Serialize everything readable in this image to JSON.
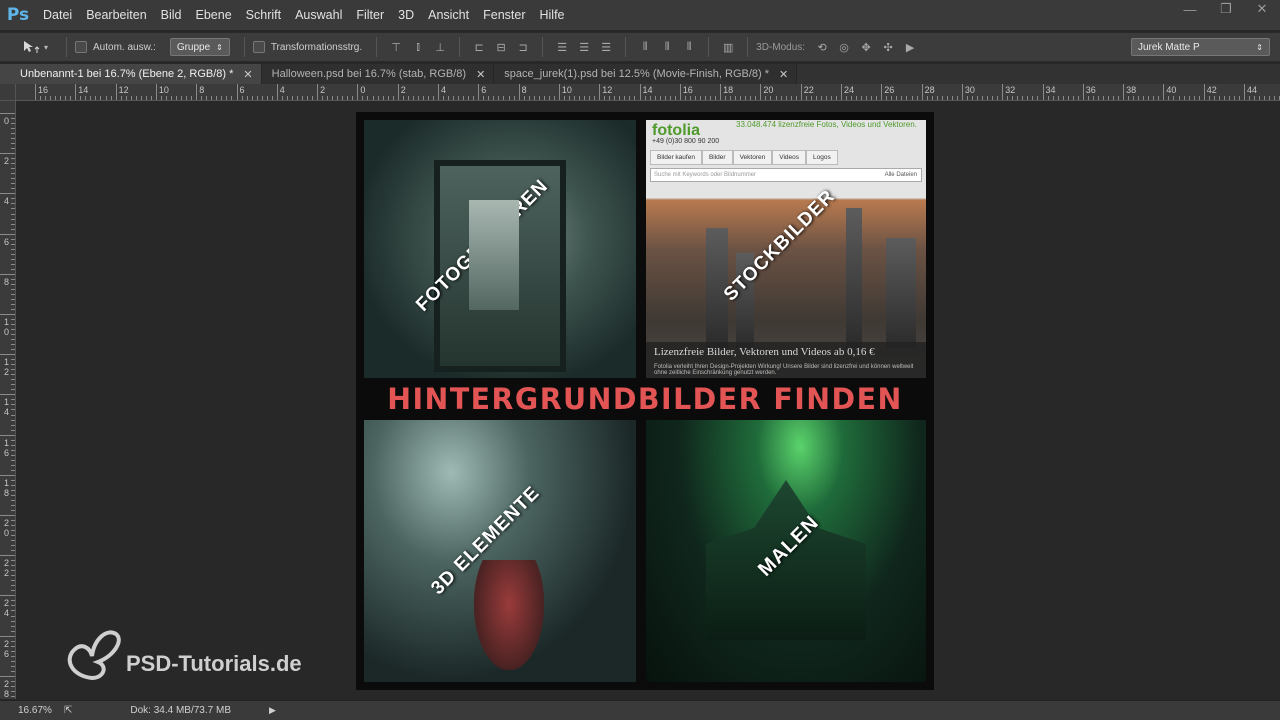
{
  "app": {
    "logo": "Ps"
  },
  "menu": [
    "Datei",
    "Bearbeiten",
    "Bild",
    "Ebene",
    "Schrift",
    "Auswahl",
    "Filter",
    "3D",
    "Ansicht",
    "Fenster",
    "Hilfe"
  ],
  "window_controls": {
    "minimize": "—",
    "restore": "❐",
    "close": "✕"
  },
  "options": {
    "auto_select_label": "Autom. ausw.:",
    "auto_select_value": "Gruppe",
    "transform_label": "Transformationsstrg.",
    "mode3d_label": "3D-Modus:",
    "workspace_value": "Jurek Matte P"
  },
  "tabs": [
    {
      "label": "Unbenannt-1 bei 16.7% (Ebene 2, RGB/8) *",
      "close": "✕"
    },
    {
      "label": "Halloween.psd bei 16.7% (stab, RGB/8)",
      "close": "✕"
    },
    {
      "label": "space_jurek(1).psd bei 12.5% (Movie-Finish, RGB/8) *",
      "close": "✕"
    }
  ],
  "ruler_top": [
    "16",
    "14",
    "12",
    "10",
    "8",
    "6",
    "4",
    "2",
    "0",
    "2",
    "4",
    "6",
    "8",
    "10",
    "12",
    "14",
    "16",
    "18",
    "20",
    "22",
    "24",
    "26",
    "28",
    "30",
    "32",
    "34",
    "36",
    "38",
    "40",
    "42",
    "44"
  ],
  "ruler_left": [
    "0",
    "2",
    "4",
    "6",
    "8",
    "1\n0",
    "1\n2",
    "1\n4",
    "1\n6",
    "1\n8",
    "2\n0",
    "2\n2",
    "2\n4",
    "2\n6",
    "2\n8"
  ],
  "canvas": {
    "labels": {
      "photo": "FOTOGRAFIEREN",
      "stock": "STOCKBILDER",
      "elements": "3D ELEMENTE",
      "paint": "MALEN"
    },
    "banner": "HINTERGRUNDBILDER FINDEN",
    "stock_site": {
      "logo": "fotolia",
      "tagline": "33.048.474 lizenzfreie Fotos, Videos und Vektoren.",
      "phone": "+49 (0)30 800 90 200",
      "nav": [
        "Bilder kaufen",
        "Bilder",
        "Vektoren",
        "Videos",
        "Logos"
      ],
      "search_placeholder": "Suche mit Keywords oder Bildnummer",
      "search_scope": "Alle Dateien",
      "footer_title": "Lizenzfreie Bilder, Vektoren und Videos ab 0,16 €",
      "footer_text": "Fotolia verleiht Ihren Design-Projekten Wirkung! Unsere Bilder sind lizenzfrei und können weltweit ohne zeitliche Einschränkung genutzt werden."
    }
  },
  "watermark": "PSD-Tutorials.de",
  "status": {
    "zoom": "16.67%",
    "doc": "Dok: 34.4 MB/73.7 MB",
    "arrow": "▶"
  }
}
